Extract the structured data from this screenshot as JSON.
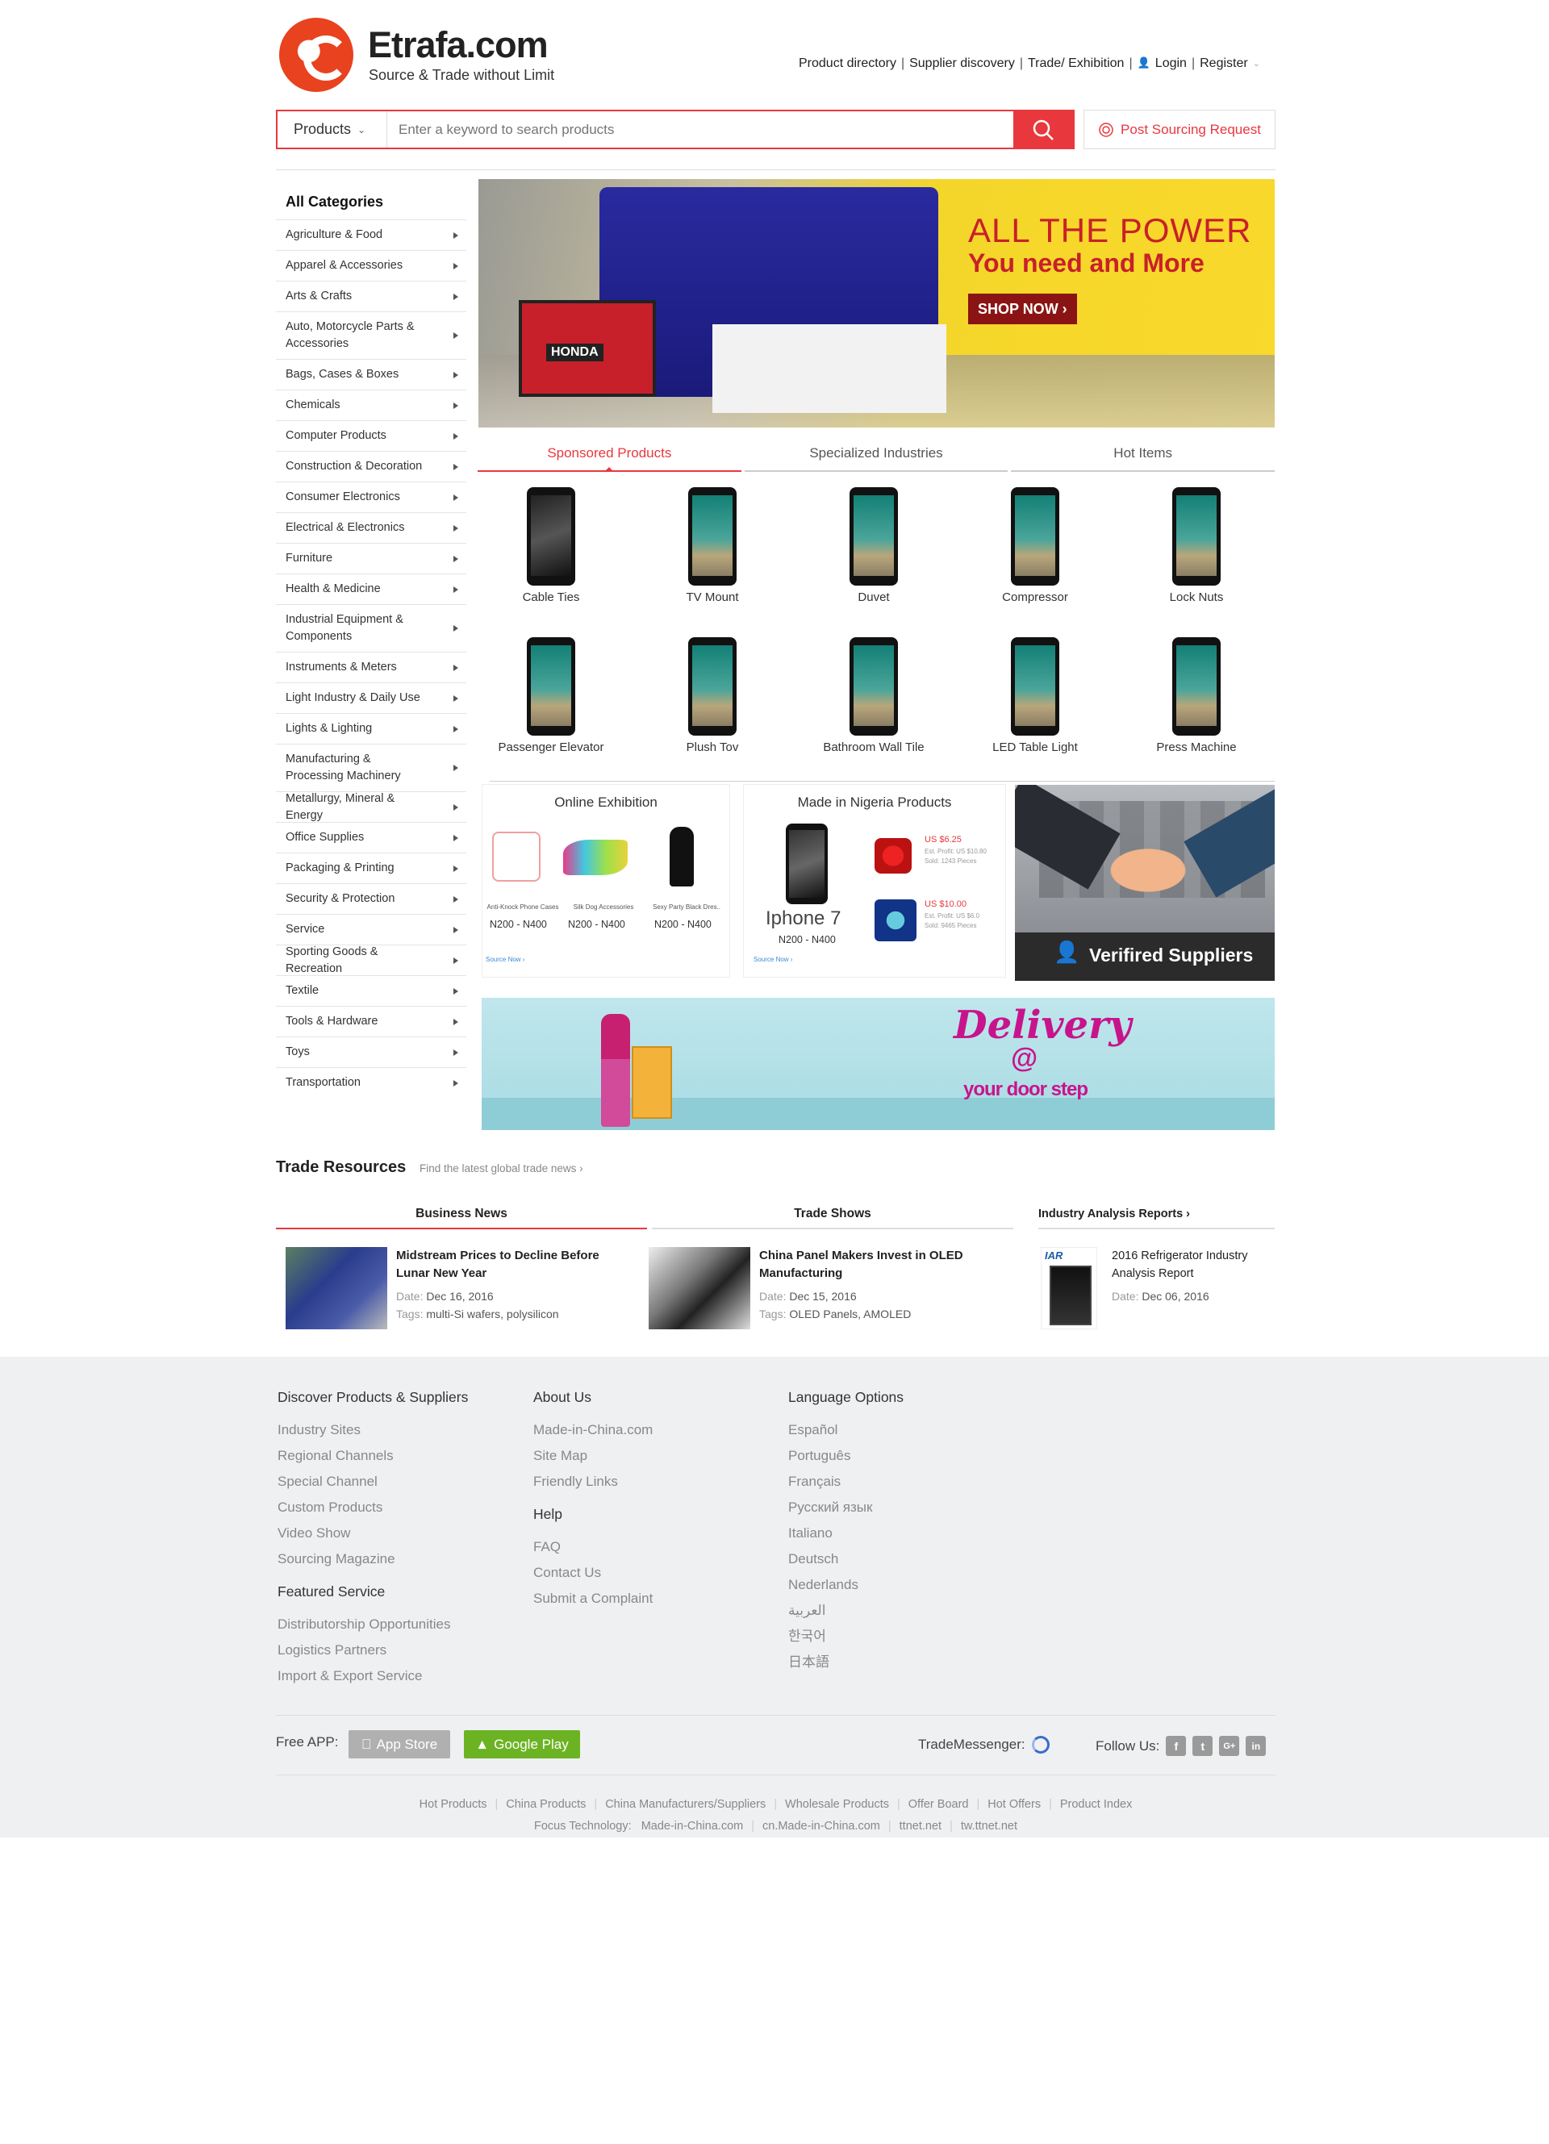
{
  "brand": {
    "name": "Etrafa.com",
    "tagline": "Source & Trade without Limit"
  },
  "topnav": {
    "items": [
      "Product directory",
      "Supplier discovery",
      "Trade/ Exhibition",
      "Login",
      "Register"
    ]
  },
  "search": {
    "category": "Products",
    "placeholder": "Enter a keyword to search products",
    "post_label": "Post Sourcing Request"
  },
  "categories": {
    "title": "All Categories",
    "items": [
      "Agriculture & Food",
      "Apparel & Accessories",
      "Arts & Crafts",
      "Auto, Motorcycle Parts & Accessories",
      "Bags, Cases & Boxes",
      "Chemicals",
      "Computer Products",
      "Construction & Decoration",
      "Consumer Electronics",
      "Electrical & Electronics",
      "Furniture",
      "Health & Medicine",
      "Industrial Equipment & Components",
      "Instruments & Meters",
      "Light Industry & Daily Use",
      "Lights & Lighting",
      "Manufacturing & Processing Machinery",
      "Metallurgy, Mineral & Energy",
      "Office Supplies",
      "Packaging & Printing",
      "Security & Protection",
      "Service",
      "Sporting Goods & Recreation",
      "Textile",
      "Tools & Hardware",
      "Toys",
      "Transportation"
    ]
  },
  "banner": {
    "line1": "ALL THE POWER",
    "line2": "You need and More",
    "cta": "SHOP NOW ›",
    "generator_brand": "HONDA"
  },
  "tabs": [
    "Sponsored Products",
    "Specialized Industries",
    "Hot Items"
  ],
  "products": [
    "Cable Ties",
    "TV Mount",
    "Duvet",
    "Compressor",
    "Lock Nuts",
    "Passenger Elevator",
    "Plush Tov",
    "Bathroom Wall Tile",
    "LED Table Light",
    "Press Machine"
  ],
  "exhibition": {
    "title": "Online Exhibition",
    "items": [
      {
        "caption": "Anti-Knock Phone Cases",
        "price": "N200 - N400"
      },
      {
        "caption": "Silk Dog Accessories",
        "price": "N200 - N400"
      },
      {
        "caption": "Sexy Party Black Dres..",
        "price": "N200 - N400"
      }
    ],
    "source_now": "Source Now ›"
  },
  "nigeria": {
    "title": "Made in Nigeria Products",
    "main_label": "Iphone 7",
    "main_price": "N200 - N400",
    "side": [
      {
        "price": "US $6.25",
        "profit": "Est. Profit: US $10.80",
        "sold": "Sold: 1243 Pieces"
      },
      {
        "price": "US $10.00",
        "profit": "Est. Profit: US $6.0",
        "sold": "Sold: 9465 Pieces"
      }
    ],
    "source_now": "Source Now ›"
  },
  "verified": {
    "label": "Verifired Suppliers"
  },
  "delivery": {
    "line1": "Delivery",
    "line2": "@",
    "line3": "your door step"
  },
  "trade": {
    "title": "Trade Resources",
    "subtitle": "Find the latest global trade news ›",
    "tabs": [
      "Business News",
      "Trade Shows",
      "Industry Analysis Reports ›"
    ],
    "news": [
      {
        "headline": "Midstream Prices to Decline Before Lunar New Year",
        "date_label": "Date:",
        "date": "Dec 16, 2016",
        "tags_label": "Tags:",
        "tags": "multi-Si wafers, polysilicon"
      },
      {
        "headline": "China Panel Makers Invest in OLED Manufacturing",
        "date_label": "Date:",
        "date": "Dec 15, 2016",
        "tags_label": "Tags:",
        "tags": "OLED Panels, AMOLED"
      },
      {
        "headline": "2016 Refrigerator Industry Analysis Report",
        "date_label": "Date:",
        "date": "Dec 06, 2016"
      }
    ],
    "report_logo": "IAR"
  },
  "footer": {
    "col1": {
      "h1": "Discover Products & Suppliers",
      "l1": [
        "Industry Sites",
        "Regional Channels",
        "Special Channel",
        "Custom Products",
        "Video Show",
        "Sourcing Magazine"
      ],
      "h2": "Featured Service",
      "l2": [
        "Distributorship Opportunities",
        "Logistics Partners",
        "Import & Export Service"
      ]
    },
    "col2": {
      "h1": "About Us",
      "l1": [
        "Made-in-China.com",
        "Site Map",
        "Friendly Links"
      ],
      "h2": "Help",
      "l2": [
        "FAQ",
        "Contact Us",
        "Submit a Complaint"
      ]
    },
    "col3": {
      "h1": "Language Options",
      "l1": [
        "Español",
        "Português",
        "Français",
        "Русский язык",
        "Italiano",
        "Deutsch",
        "Nederlands",
        "العربية",
        "한국어",
        "日本語"
      ]
    },
    "free_app": "Free APP:",
    "app_store": "App Store",
    "google_play": "Google Play",
    "trade_messenger": "TradeMessenger:",
    "follow_us": "Follow Us:",
    "social": [
      "f",
      "t",
      "G+",
      "in"
    ],
    "links1": [
      "Hot Products",
      "China Products",
      "China Manufacturers/Suppliers",
      "Wholesale Products",
      "Offer Board",
      "Hot Offers",
      "Product Index"
    ],
    "links2_label": "Focus Technology:",
    "links2": [
      "Made-in-China.com",
      "cn.Made-in-China.com",
      "ttnet.net",
      "tw.ttnet.net"
    ]
  },
  "colors": {
    "accent": "#e8383d",
    "banner_yellow": "#f9d92b",
    "gplay_green": "#6cb324",
    "delivery_pink": "#c8148c"
  }
}
